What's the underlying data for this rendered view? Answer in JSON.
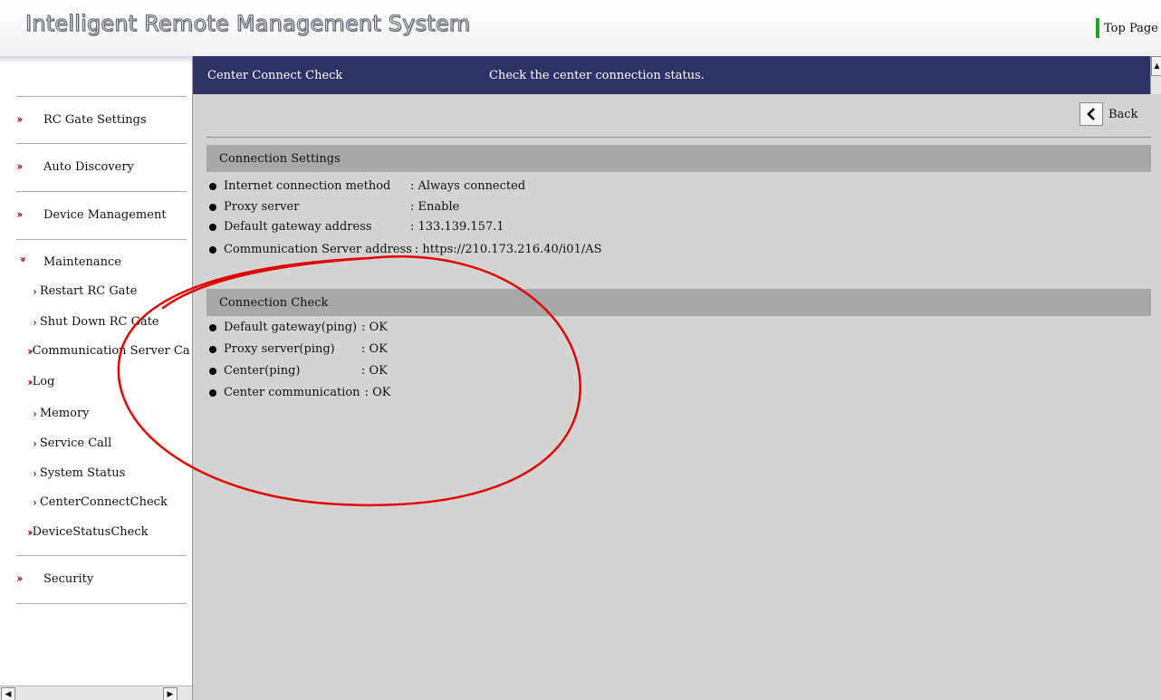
{
  "header": {
    "app_title": "Intelligent Remote Management System",
    "top_page_label": "Top Page"
  },
  "sidebar": {
    "items": [
      {
        "label": "RC Gate Settings"
      },
      {
        "label": "Auto Discovery"
      },
      {
        "label": "Device Management"
      },
      {
        "label": "Maintenance"
      },
      {
        "label": "Security"
      }
    ],
    "maintenance_sub": [
      {
        "label": "Restart RC Gate"
      },
      {
        "label": "Shut Down RC Gate"
      },
      {
        "label": "Communication Server Ca"
      },
      {
        "label": "Log"
      },
      {
        "label": "Memory"
      },
      {
        "label": "Service Call"
      },
      {
        "label": "System Status"
      },
      {
        "label": "CenterConnectCheck"
      },
      {
        "label": "DeviceStatusCheck"
      }
    ]
  },
  "main": {
    "page_title": "Center Connect Check",
    "page_description": "Check the center connection status.",
    "back_label": "Back",
    "connection_settings": {
      "title": "Connection Settings",
      "rows": [
        {
          "key": "Internet connection method",
          "value": ": Always connected"
        },
        {
          "key": "Proxy server",
          "value": ": Enable"
        },
        {
          "key": "Default gateway address",
          "value": ": 133.139.157.1"
        },
        {
          "key": "Communication Server address",
          "value": ": https://210.173.216.40/i01/AS"
        }
      ]
    },
    "connection_check": {
      "title": "Connection Check",
      "rows": [
        {
          "key": "Default gateway(ping)",
          "value": ": OK"
        },
        {
          "key": "Proxy server(ping)",
          "value": ": OK"
        },
        {
          "key": "Center(ping)",
          "value": ": OK"
        },
        {
          "key": "Center communication",
          "value": ": OK"
        }
      ]
    }
  },
  "annotation": {
    "ellipse_color": "#e00000"
  }
}
